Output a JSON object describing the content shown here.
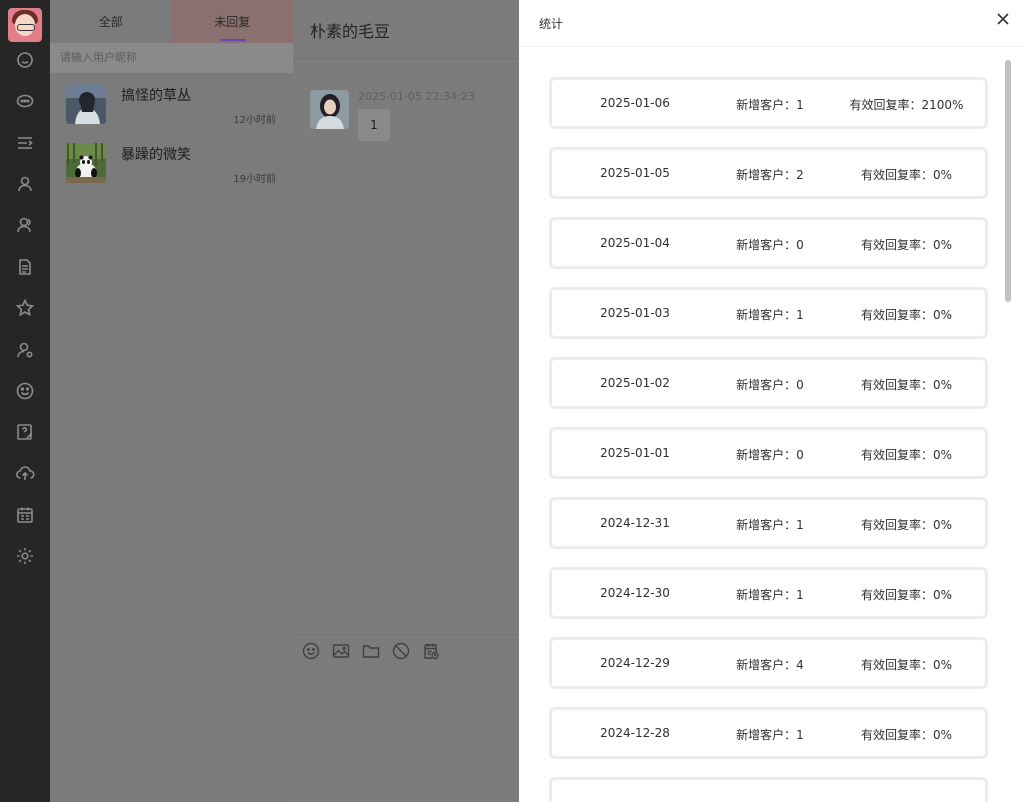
{
  "tabs": {
    "all": "全部",
    "unreplied": "未回复"
  },
  "search": {
    "placeholder": "请输入用户昵称"
  },
  "contacts": [
    {
      "name": "搞怪的草丛",
      "time": "12小时前"
    },
    {
      "name": "暴躁的微笑",
      "time": "19小时前"
    }
  ],
  "chat": {
    "title": "朴素的毛豆",
    "message_time": "2025-01-05 22:34:23",
    "message_text": "1"
  },
  "modal": {
    "title": "统计",
    "rows": [
      {
        "date": "2025-01-06",
        "new_customers": "新增客户：1",
        "reply_rate": "有效回复率：2100%"
      },
      {
        "date": "2025-01-05",
        "new_customers": "新增客户：2",
        "reply_rate": "有效回复率：0%"
      },
      {
        "date": "2025-01-04",
        "new_customers": "新增客户：0",
        "reply_rate": "有效回复率：0%"
      },
      {
        "date": "2025-01-03",
        "new_customers": "新增客户：1",
        "reply_rate": "有效回复率：0%"
      },
      {
        "date": "2025-01-02",
        "new_customers": "新增客户：0",
        "reply_rate": "有效回复率：0%"
      },
      {
        "date": "2025-01-01",
        "new_customers": "新增客户：0",
        "reply_rate": "有效回复率：0%"
      },
      {
        "date": "2024-12-31",
        "new_customers": "新增客户：1",
        "reply_rate": "有效回复率：0%"
      },
      {
        "date": "2024-12-30",
        "new_customers": "新增客户：1",
        "reply_rate": "有效回复率：0%"
      },
      {
        "date": "2024-12-29",
        "new_customers": "新增客户：4",
        "reply_rate": "有效回复率：0%"
      },
      {
        "date": "2024-12-28",
        "new_customers": "新增客户：1",
        "reply_rate": "有效回复率：0%"
      }
    ]
  },
  "icons": {
    "rail": [
      "smile-icon",
      "chat-bubbles-icon",
      "list-indent-icon",
      "user-icon",
      "users-icon",
      "document-icon",
      "star-icon",
      "user-settings-icon",
      "emoji-icon",
      "help-edit-icon",
      "cloud-upload-icon",
      "calendar-list-icon",
      "gear-icon"
    ],
    "composer": [
      "emoji-icon",
      "image-icon",
      "folder-icon",
      "block-icon",
      "schedule-icon"
    ]
  }
}
